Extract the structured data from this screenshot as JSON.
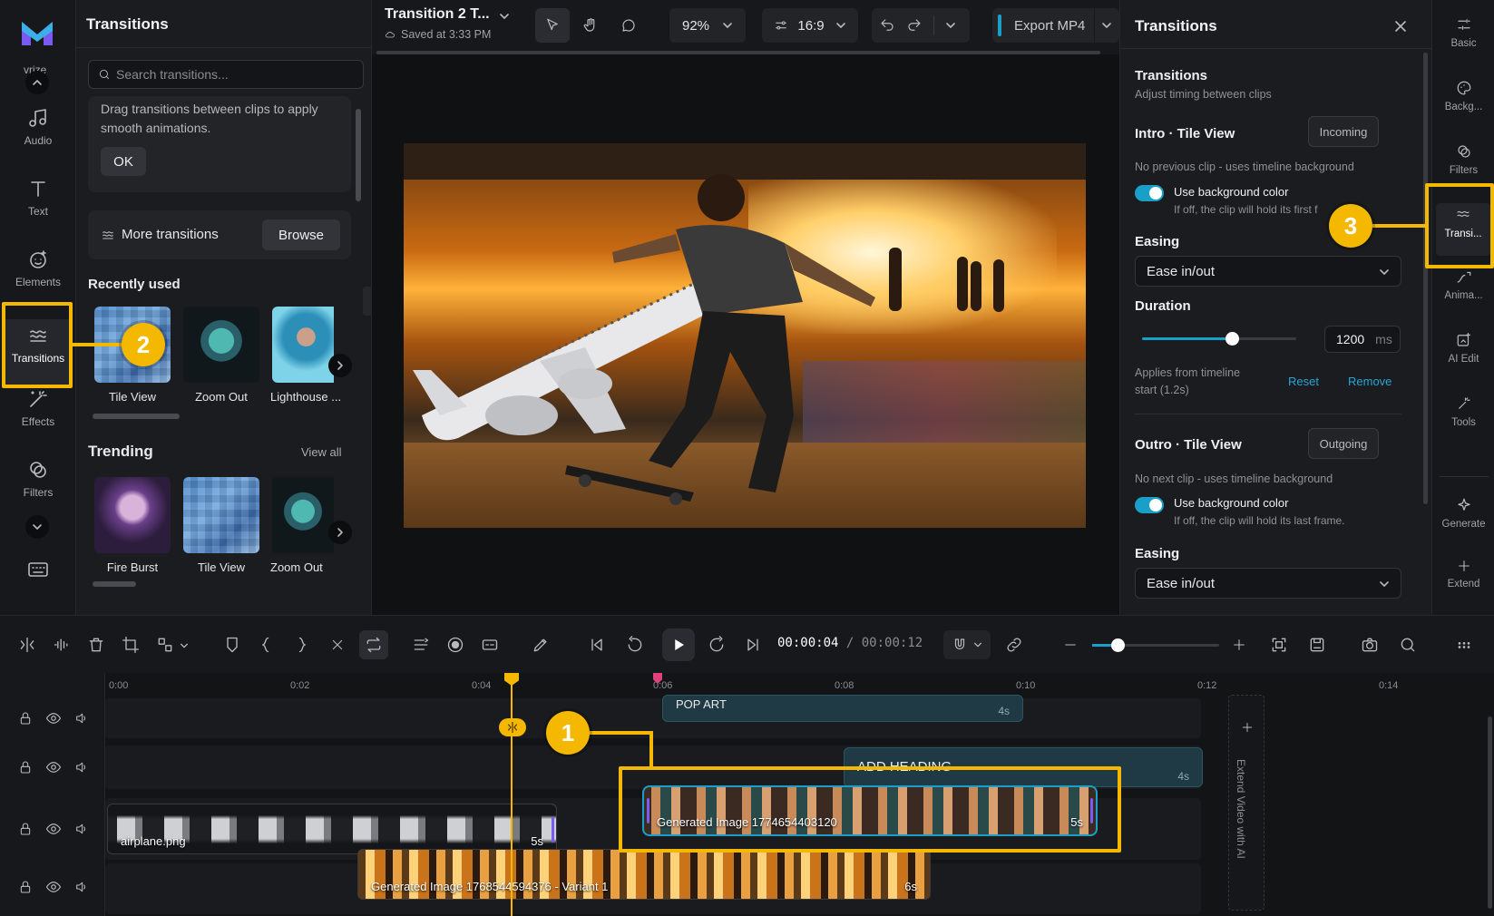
{
  "app": {
    "logo_text": "vrize"
  },
  "left_rail": {
    "items": [
      {
        "label": "Audio",
        "icon": "music-note-icon"
      },
      {
        "label": "Text",
        "icon": "text-icon"
      },
      {
        "label": "Elements",
        "icon": "elements-icon"
      },
      {
        "label": "Transitions",
        "icon": "transitions-icon",
        "active": true
      },
      {
        "label": "Effects",
        "icon": "magic-wand-icon"
      },
      {
        "label": "Filters",
        "icon": "filters-icon"
      }
    ]
  },
  "transitions_panel": {
    "title": "Transitions",
    "search_placeholder": "Search transitions...",
    "tip_text": "Drag transitions between clips to apply smooth animations.",
    "tip_ok": "OK",
    "more_label": "More transitions",
    "browse_label": "Browse",
    "recent_title": "Recently used",
    "recent": [
      "Tile View",
      "Zoom Out",
      "Lighthouse ..."
    ],
    "trending_title": "Trending",
    "view_all": "View all",
    "trending": [
      "Fire Burst",
      "Tile View",
      "Zoom Out"
    ]
  },
  "topbar": {
    "project_title": "Transition 2 T...",
    "saved_text": "Saved at 3:33 PM",
    "zoom": "92%",
    "aspect": "16:9",
    "export_label": "Export MP4"
  },
  "right_panel": {
    "title": "Transitions",
    "section_title": "Transitions",
    "section_sub": "Adjust timing between clips",
    "intro": {
      "title": "Intro · Tile View",
      "tag": "Incoming",
      "note": "No previous clip - uses timeline background",
      "toggle_label": "Use background color",
      "toggle_help": "If off, the clip will hold its first f",
      "easing_label": "Easing",
      "easing_value": "Ease in/out",
      "duration_label": "Duration",
      "duration_value": "1200",
      "duration_unit": "ms",
      "duration_fraction": 0.58,
      "applies_text_1": "Applies from timeline",
      "applies_text_2": "start (1.2s)",
      "reset": "Reset",
      "remove": "Remove"
    },
    "outro": {
      "title": "Outro · Tile View",
      "tag": "Outgoing",
      "note": "No next clip - uses timeline background",
      "toggle_label": "Use background color",
      "toggle_help": "If off, the clip will hold its last frame.",
      "easing_label": "Easing",
      "easing_value": "Ease in/out"
    }
  },
  "right_rail": {
    "items": [
      "Basic",
      "Backg...",
      "Filters",
      "Transi...",
      "Anima...",
      "AI Edit",
      "Tools",
      "Generate",
      "Extend"
    ]
  },
  "playback": {
    "current_time": "00:00:04",
    "separator": "/",
    "total_time": "00:00:12",
    "zoom_fraction": 0.2
  },
  "timeline": {
    "ruler": [
      "0:00",
      "0:02",
      "0:04",
      "0:06",
      "0:08",
      "0:10",
      "0:12",
      "0:14"
    ],
    "clips": {
      "pop_art": {
        "label": "POP ART",
        "duration": "4s"
      },
      "heading": {
        "label": "ADD HEADING",
        "duration": "4s"
      },
      "airplane": {
        "label": "airplane.png",
        "duration": "5s"
      },
      "generated": {
        "label": "Generated Image 1774654403120",
        "duration": "5s"
      },
      "variant": {
        "label": "Generated Image 1768544594376 - Variant 1",
        "duration": "6s"
      }
    },
    "extend_label": "Extend Video with AI"
  },
  "callouts": [
    "1",
    "2",
    "3"
  ],
  "colors": {
    "accent": "#1aa0c8",
    "highlight": "#f5b800",
    "playhead": "#f5b800"
  }
}
